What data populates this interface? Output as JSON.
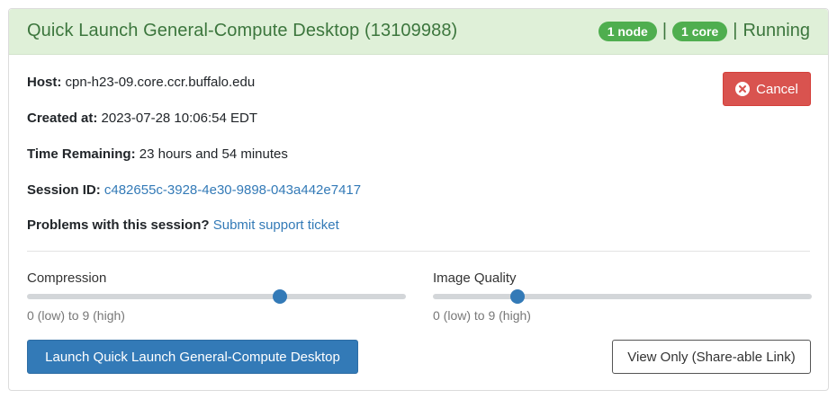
{
  "header": {
    "title": "Quick Launch General-Compute Desktop (13109988)",
    "node_badge": "1 node",
    "core_badge": "1 core",
    "separator": "|",
    "status": "Running"
  },
  "info": {
    "host_label": "Host:",
    "host_value": "cpn-h23-09.core.ccr.buffalo.edu",
    "created_label": "Created at:",
    "created_value": "2023-07-28 10:06:54 EDT",
    "time_label": "Time Remaining:",
    "time_value": "23 hours and 54 minutes",
    "session_label": "Session ID:",
    "session_value": "c482655c-3928-4e30-9898-043a442e7417",
    "problems_label": "Problems with this session?",
    "support_link": "Submit support ticket"
  },
  "cancel": {
    "label": "Cancel",
    "icon": "times-circle-icon",
    "color": "#d9534f"
  },
  "compression": {
    "label": "Compression",
    "hint": "0 (low) to 9 (high)",
    "value": 6,
    "min": 0,
    "max": 9
  },
  "image_quality": {
    "label": "Image Quality",
    "hint": "0 (low) to 9 (high)",
    "value": 2,
    "min": 0,
    "max": 9
  },
  "buttons": {
    "launch": "Launch Quick Launch General-Compute Desktop",
    "view_only": "View Only (Share-able Link)"
  },
  "colors": {
    "header_bg": "#dff0d8",
    "header_text": "#3c763d",
    "badge": "#4fae4f",
    "primary": "#337ab7"
  }
}
